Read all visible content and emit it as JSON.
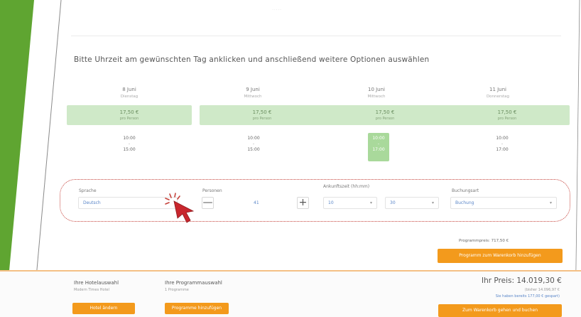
{
  "header": {
    "logo_text": "·····"
  },
  "instruction": "Bitte Uhrzeit am gewünschten Tag anklicken und anschließend weitere Optionen auswählen",
  "days": [
    {
      "date": "8 Juni",
      "weekday": "Dienstag",
      "price": "17,50 €",
      "per": "pro Person",
      "start": "10:00",
      "sep": "-",
      "end": "15:00",
      "selected": false
    },
    {
      "date": "9 Juni",
      "weekday": "Mittwoch",
      "price": "17,50 €",
      "per": "pro Person",
      "start": "10:00",
      "sep": "-",
      "end": "15:00",
      "selected": false
    },
    {
      "date": "10 Juni",
      "weekday": "Mittwoch",
      "price": "17,50 €",
      "per": "pro Person",
      "start": "10:00",
      "sep": "-",
      "end": "17:00",
      "selected": true
    },
    {
      "date": "11 Juni",
      "weekday": "Donnerstag",
      "price": "17,50 €",
      "per": "pro Person",
      "start": "10:00",
      "sep": "-",
      "end": "17:00",
      "selected": false
    }
  ],
  "options": {
    "sprache_label": "Sprache",
    "sprache_value": "Deutsch",
    "personen_label": "Personen",
    "personen_value": "41",
    "minus": "—",
    "plus": "+",
    "ankunft_label": "Ankunftszeit (hh:mm)",
    "hour_value": "10",
    "minute_value": "30",
    "buchung_label": "Buchungsart",
    "buchung_value": "Buchung",
    "caret": "▾"
  },
  "programmpreis": "Programmpreis: 717,50 €",
  "add_program_button": "Programm zum Warenkorb hinzufügen",
  "footer": {
    "hotel_title": "Ihre Hotelauswahl",
    "hotel_sub": "Modern Times Hotel",
    "hotel_button": "Hotel ändern",
    "program_title": "Ihre Programmauswahl",
    "program_sub": "1 Programme",
    "program_button": "Programme hinzufügen",
    "total": "Ihr Preis: 14.019,30 €",
    "old_price": "(bisher 14.096,97 €",
    "savings": "Sie haben bereits 177,00 € gespart)",
    "checkout_button": "Zum Warenkorb gehen und buchen"
  },
  "colors": {
    "green": "#5fa531",
    "orange": "#f39a1c",
    "highlight": "#c5413a"
  }
}
